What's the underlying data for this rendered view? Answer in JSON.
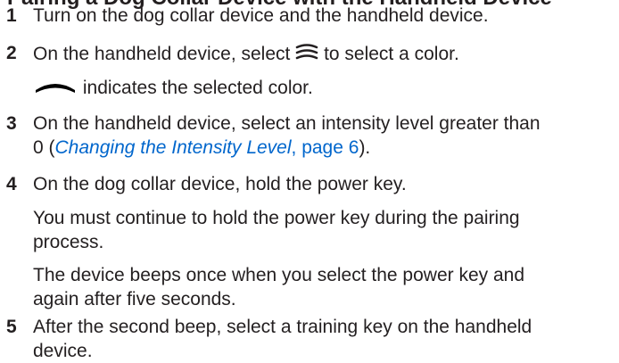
{
  "heading_partial": "Pairing a Dog Collar Device with the Handheld Device",
  "steps": [
    {
      "number": "1",
      "text": "Turn on the dog collar device and the handheld device."
    },
    {
      "number": "2",
      "text_before_icon": "On the handheld device, select",
      "icon": "color-select-icon",
      "text_after_icon": "to select a color.",
      "note_icon": "collar-strap-icon",
      "note_text": "indicates the selected color."
    },
    {
      "number": "3",
      "line1": "On the handheld device, select an intensity level greater than",
      "line2_prefix": "0 (",
      "xref_title": "Changing the Intensity Level",
      "xref_page": ", page 6",
      "line2_suffix": ")."
    },
    {
      "number": "4",
      "text": "On the dog collar device, hold the power key.",
      "para1_line1": "You must continue to hold the power key during the pairing",
      "para1_line2": "process.",
      "para2_line1": "The device beeps once when you select the power key and",
      "para2_line2": "again after five seconds."
    },
    {
      "number": "5",
      "line1": "After the second beep, select a training key on the handheld",
      "line2": "device."
    }
  ],
  "colors": {
    "text": "#231f20",
    "link": "#0066cc"
  }
}
